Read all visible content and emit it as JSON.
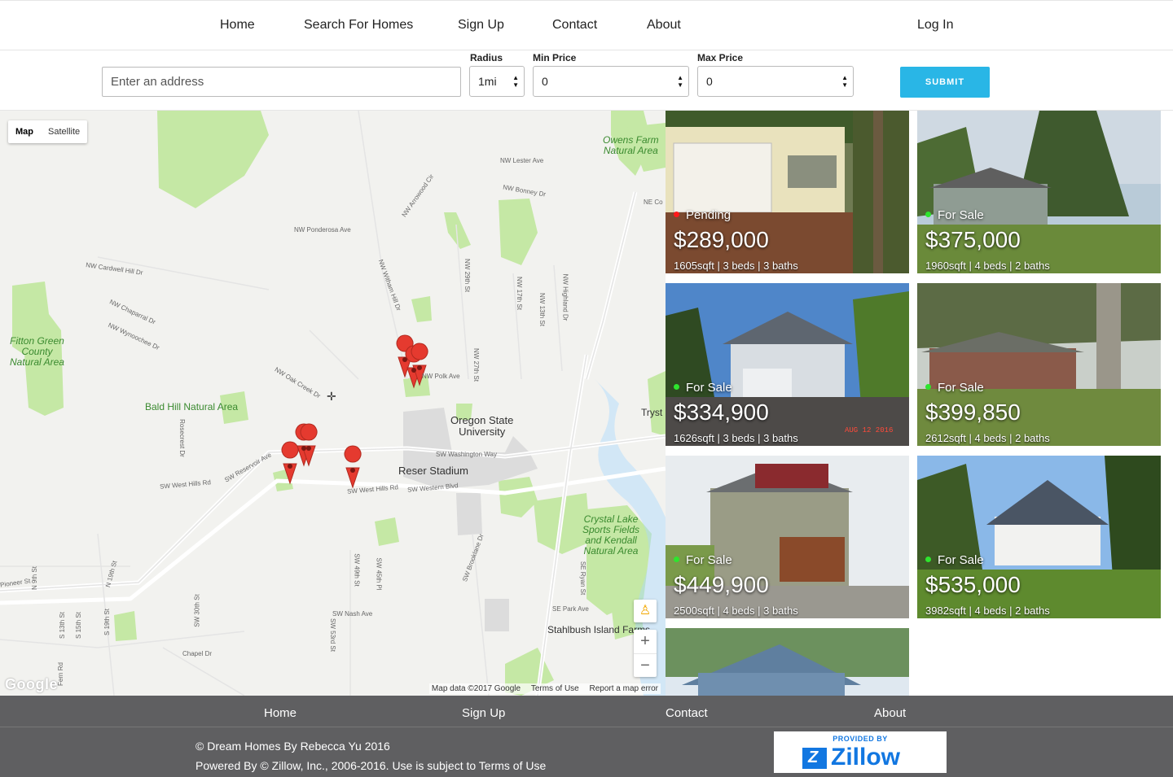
{
  "nav": {
    "home": "Home",
    "search": "Search For Homes",
    "signup": "Sign Up",
    "contact": "Contact",
    "about": "About",
    "login": "Log In"
  },
  "search": {
    "address_placeholder": "Enter an address",
    "radius_label": "Radius",
    "radius_value": "1mi",
    "min_label": "Min Price",
    "min_value": "0",
    "max_label": "Max Price",
    "max_value": "0",
    "submit_label": "SUBMIT"
  },
  "map": {
    "type_map": "Map",
    "type_satellite": "Satellite",
    "zoom_in": "+",
    "zoom_out": "−",
    "google_logo": "Google",
    "map_data": "Map data ©2017 Google",
    "terms": "Terms of Use",
    "report": "Report a map error",
    "parks": {
      "fitton": "Fitton Green\nCounty\nNatural Area",
      "bald_hill": "Bald Hill Natural Area",
      "owens": "Owens Farm\nNatural Area",
      "crystal": "Crystal Lake\nSports Fields\nand Kendall\nNatural Area"
    },
    "poi": {
      "osu": "Oregon State\nUniversity",
      "reser": "Reser Stadium",
      "stahlbush": "Stahlbush Island Farms",
      "tryst": "Tryst"
    },
    "streets": {
      "lester": "NW Lester Ave",
      "bonney": "NW Bonney Dr",
      "ne_co": "NE Co",
      "arrowood": "NW Arrowood Cir",
      "ponderosa": "NW Ponderosa Ave",
      "cardwell": "NW Cardwell Hill Dr",
      "chaparral": "NW Chaparral Dr",
      "wynoochee": "NW Wynoochee Dr",
      "oak_creek": "NW Oak Creek Dr",
      "polk": "NW Polk Ave",
      "washington": "SW Washington Way",
      "western": "SW Western Blvd",
      "west_hills": "SW West Hills Rd",
      "west_hills_2": "SW West Hills Rd",
      "reservoir": "SW Reservoir Ave",
      "rosecrest": "Rosecrest Dr",
      "nash": "SW Nash Ave",
      "park": "SE Park Ave",
      "chapel": "Chapel Dr",
      "pioneer": "Pioneer St",
      "n9": "N 9th St",
      "n19": "N 19th St",
      "s13": "S 13th St",
      "s15": "S 15th St",
      "s19": "S 19th St",
      "s30": "SW 30th St",
      "s49": "SW 49th St",
      "s45": "SW 45th Pl",
      "s53": "SW 53rd St",
      "brooklane": "SW Brooklane Dr",
      "ryan": "SE Ryan St",
      "fern": "Fern Rd",
      "nw29": "NW 29th St",
      "nw27": "NW 27th St",
      "nw17": "NW 17th St",
      "nw13": "NW 13th St",
      "nw_highland": "NW Highland Dr",
      "nw_witham": "NW Witham Hill Dr"
    }
  },
  "listings": [
    {
      "status": "Pending",
      "status_color": "#ff1a1a",
      "price": "$289,000",
      "specs": "1605sqft | 3 beds | 3 baths"
    },
    {
      "status": "For Sale",
      "status_color": "#2ee52e",
      "price": "$375,000",
      "specs": "1960sqft | 4 beds | 2 baths"
    },
    {
      "status": "For Sale",
      "status_color": "#2ee52e",
      "price": "$334,900",
      "specs": "1626sqft | 3 beds | 3 baths",
      "stamp": "AUG 12 2016"
    },
    {
      "status": "For Sale",
      "status_color": "#2ee52e",
      "price": "$399,850",
      "specs": "2612sqft | 4 beds | 2 baths"
    },
    {
      "status": "For Sale",
      "status_color": "#2ee52e",
      "price": "$449,900",
      "specs": "2500sqft | 4 beds | 3 baths"
    },
    {
      "status": "For Sale",
      "status_color": "#2ee52e",
      "price": "$535,000",
      "specs": "3982sqft | 4 beds | 2 baths"
    }
  ],
  "footer": {
    "home": "Home",
    "signup": "Sign Up",
    "contact": "Contact",
    "about": "About",
    "copyright": "© Dream Homes By Rebecca Yu 2016",
    "powered": "Powered By © Zillow, Inc., 2006-2016. Use is subject to Terms of Use",
    "zillow_provided": "PROVIDED BY",
    "zillow_brand": "Zillow"
  },
  "colors": {
    "accent": "#29b6e6",
    "footer_bg": "#5f5f61",
    "park_green": "#c5e8a5",
    "pin_red": "#e53a2f",
    "zillow_blue": "#1277e1"
  }
}
